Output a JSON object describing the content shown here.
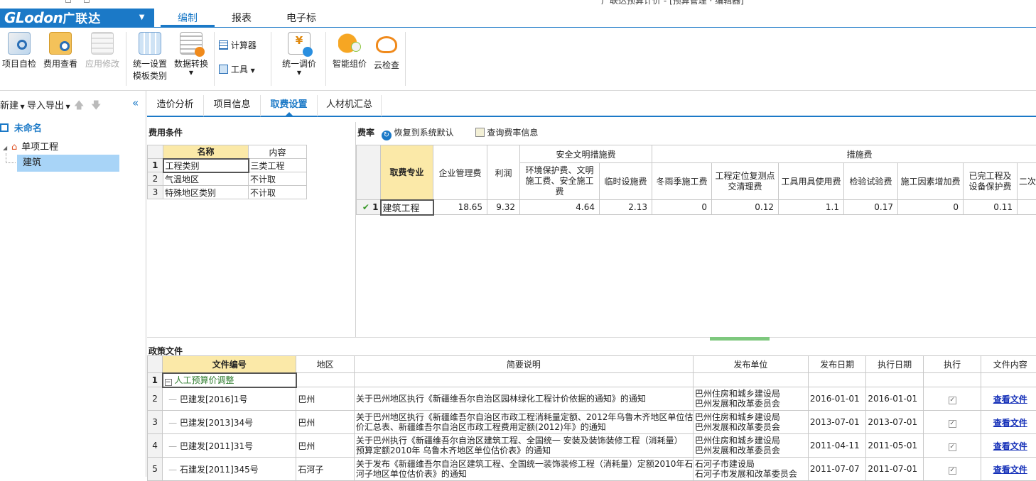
{
  "app": {
    "brand_latin": "GLodon",
    "brand_cn": "广联达",
    "title_partial": "广联达预算计价 - [预算管理 · 编辑器]"
  },
  "menu_tabs": [
    "编制",
    "报表",
    "电子标"
  ],
  "ribbon": {
    "btn_check": "项目自检",
    "btn_fee_view": "费用查看",
    "btn_apply_mod": "应用修改",
    "btn_unify_set_1": "统一设置",
    "btn_unify_set_2": "模板类别",
    "btn_data_convert": "数据转换",
    "btn_calculator": "计算器",
    "btn_tools": "工具",
    "btn_unify_price": "统一调价",
    "btn_smart_price": "智能组价",
    "btn_cloud_check": "云检查"
  },
  "left": {
    "new_label": "新建",
    "import_export_label": "导入导出",
    "root": "未命名",
    "project": "单项工程",
    "unit": "建筑"
  },
  "subtabs": [
    "造价分析",
    "项目信息",
    "取费设置",
    "人材机汇总"
  ],
  "fee_conditions": {
    "title": "费用条件",
    "headers": [
      "名称",
      "内容"
    ],
    "rows": [
      {
        "n": "1",
        "name": "工程类别",
        "value": "三类工程"
      },
      {
        "n": "2",
        "name": "气温地区",
        "value": "不计取"
      },
      {
        "n": "3",
        "name": "特殊地区类别",
        "value": "不计取"
      }
    ]
  },
  "rates": {
    "title": "费率",
    "restore_label": "恢复到系统默认",
    "query_label": "查询费率信息",
    "col_specialty": "取费专业",
    "col_mgmt": "企业管理费",
    "col_profit": "利润",
    "group_safety": "安全文明措施费",
    "col_env": "环境保护费、文明施工费、安全施工费",
    "col_temp": "临时设施费",
    "group_measures": "措施费",
    "col_winter": "冬雨季施工费",
    "col_locate": "工程定位复测点交清理费",
    "col_tools": "工具用具使用费",
    "col_test": "检验试验费",
    "col_factor": "施工因素增加费",
    "col_done": "已完工程及设备保护费",
    "col_second": "二次搬",
    "row": {
      "n": "1",
      "specialty": "建筑工程",
      "mgmt": "18.65",
      "profit": "9.32",
      "env": "4.64",
      "temp": "2.13",
      "winter": "0",
      "locate": "0.12",
      "tools": "1.1",
      "test": "0.17",
      "factor": "0",
      "done": "0.11"
    }
  },
  "policy": {
    "title": "政策文件",
    "headers": [
      "文件编号",
      "地区",
      "简要说明",
      "发布单位",
      "发布日期",
      "执行日期",
      "执行",
      "文件内容"
    ],
    "group_row": {
      "n": "1",
      "label": "人工预算价调整"
    },
    "rows": [
      {
        "n": "2",
        "code": "巴建发[2016]1号",
        "region": "巴州",
        "desc1": "关于巴州地区执行《新疆维吾尔自治区园林绿化工程计价依据的通知》的通知",
        "desc2": "",
        "pub1": "巴州住房和城乡建设局",
        "pub2": "巴州发展和改革委员会",
        "pub_date": "2016-01-01",
        "exec_date": "2016-01-01",
        "link": "查看文件"
      },
      {
        "n": "3",
        "code": "巴建发[2013]34号",
        "region": "巴州",
        "desc1": "关于巴州地区执行《新疆维吾尔自治区市政工程消耗量定额、2012年乌鲁木齐地区单位估",
        "desc2": "价汇总表、新疆维吾尔自治区市政工程费用定额(2012)年》的通知",
        "pub1": "巴州住房和城乡建设局",
        "pub2": "巴州发展和改革委员会",
        "pub_date": "2013-07-01",
        "exec_date": "2013-07-01",
        "link": "查看文件"
      },
      {
        "n": "4",
        "code": "巴建发[2011]31号",
        "region": "巴州",
        "desc1": "关于巴州执行《新疆维吾尔自治区建筑工程、全国统一 安装及装饰装修工程（消耗量）",
        "desc2": "预算定额2010年 乌鲁木齐地区单位估价表》的通知",
        "pub1": "巴州住房和城乡建设局",
        "pub2": "巴州发展和改革委员会",
        "pub_date": "2011-04-11",
        "exec_date": "2011-05-01",
        "link": "查看文件"
      },
      {
        "n": "5",
        "code": "石建发[2011]345号",
        "region": "石河子",
        "desc1": "关于发布《新疆维吾尔自治区建筑工程、全国统一装饰装修工程（消耗量）定额2010年石",
        "desc2": "河子地区单位估价表》的通知",
        "pub1": "石河子市建设局",
        "pub2": "石河子市发展和改革委员会",
        "pub_date": "2011-07-07",
        "exec_date": "2011-07-01",
        "link": "查看文件"
      }
    ]
  },
  "colors": {
    "accent": "#1b79c7",
    "header_yellow": "#fbe9a8",
    "link": "#1530b8",
    "splitter_green": "#7ec87e"
  }
}
